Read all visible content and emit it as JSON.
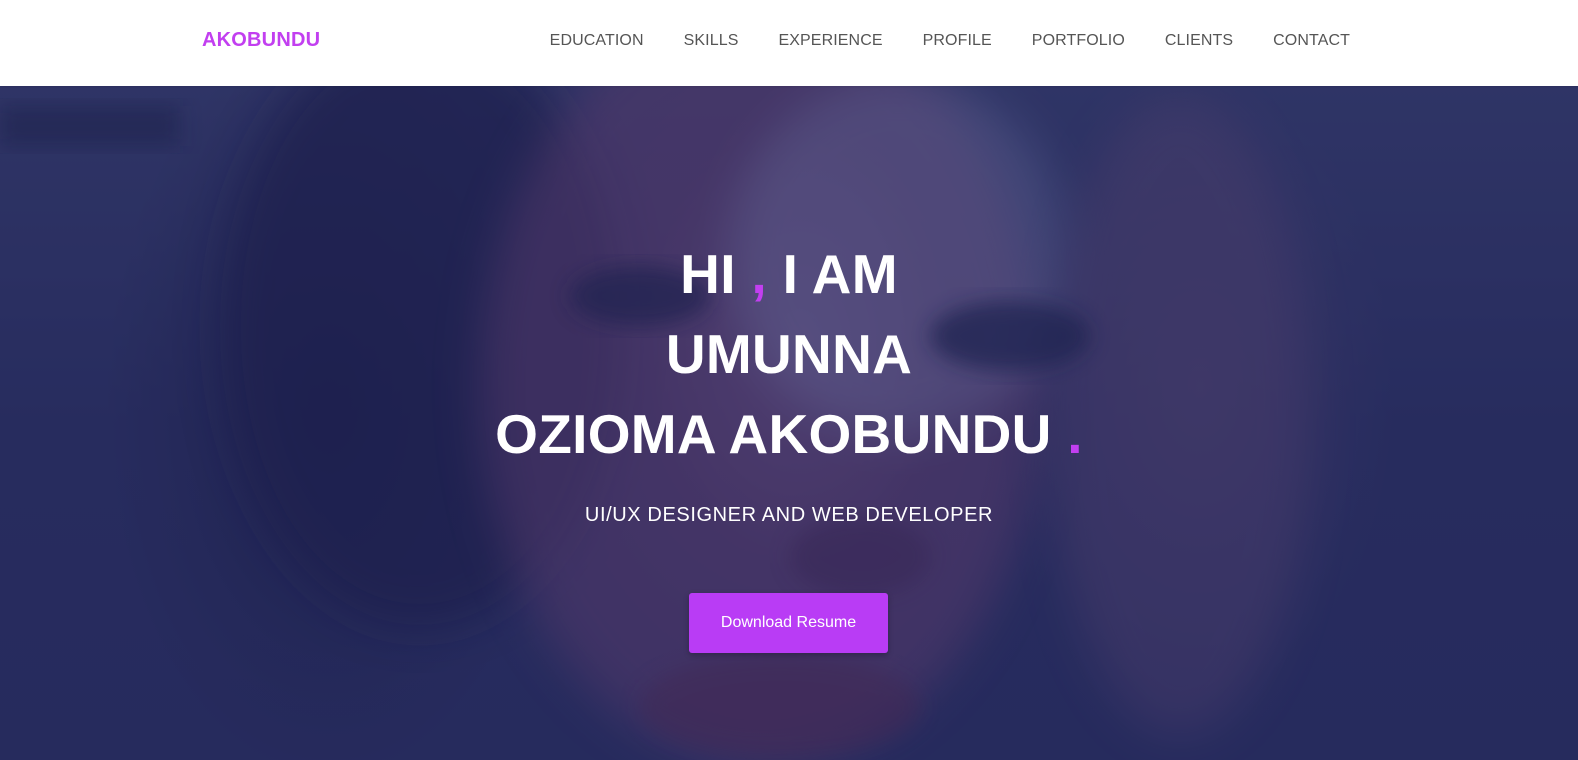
{
  "nav": {
    "brand": "AKOBUNDU",
    "links": [
      "EDUCATION",
      "SKILLS",
      "EXPERIENCE",
      "PROFILE",
      "PORTFOLIO",
      "CLIENTS",
      "CONTACT"
    ]
  },
  "hero": {
    "greeting_hi": "HI",
    "greeting_comma": ",",
    "greeting_iam": "I AM",
    "name_line1": "UMUNNA",
    "name_line2": "OZIOMA AKOBUNDU",
    "name_period": ".",
    "subtitle": "UI/UX DESIGNER AND WEB DEVELOPER",
    "cta_label": "Download Resume"
  },
  "colors": {
    "accent": "#c23ff0",
    "button": "#b93cf5",
    "nav_text": "#555555",
    "hero_overlay": "#21265c"
  }
}
